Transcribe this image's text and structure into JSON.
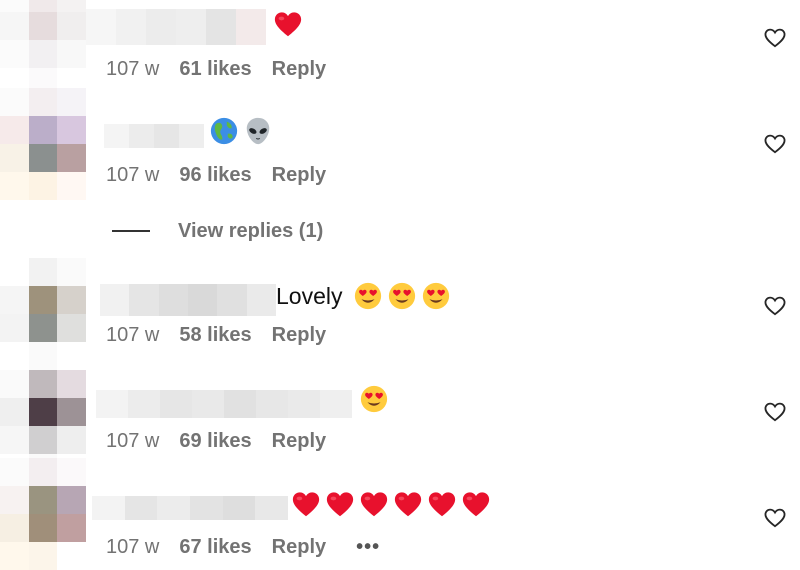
{
  "comments": [
    {
      "text": "",
      "time": "107 w",
      "likes": "61 likes",
      "reply": "Reply",
      "emojis": [
        "red-heart"
      ]
    },
    {
      "text": "",
      "time": "107 w",
      "likes": "96 likes",
      "reply": "Reply",
      "emojis": [
        "globe-americas",
        "alien"
      ]
    },
    {
      "text": "Lovely",
      "time": "107 w",
      "likes": "58 likes",
      "reply": "Reply",
      "emojis": [
        "heart-eyes",
        "heart-eyes",
        "heart-eyes"
      ]
    },
    {
      "text": "",
      "time": "107 w",
      "likes": "69 likes",
      "reply": "Reply",
      "emojis": [
        "heart-eyes"
      ]
    },
    {
      "text": "",
      "time": "107 w",
      "likes": "67 likes",
      "reply": "Reply",
      "more": "•••",
      "emojis": [
        "red-heart",
        "red-heart",
        "red-heart",
        "red-heart",
        "red-heart",
        "red-heart"
      ]
    }
  ],
  "view_replies": "View replies (1)",
  "icons": {
    "like": "heart-outline-icon",
    "more": "more-horizontal-icon"
  },
  "colors": {
    "meta_text": "#737373",
    "comment_text": "#111111",
    "heart_red": "#e8112d",
    "emoji_yellow": "#ffcb3d"
  }
}
